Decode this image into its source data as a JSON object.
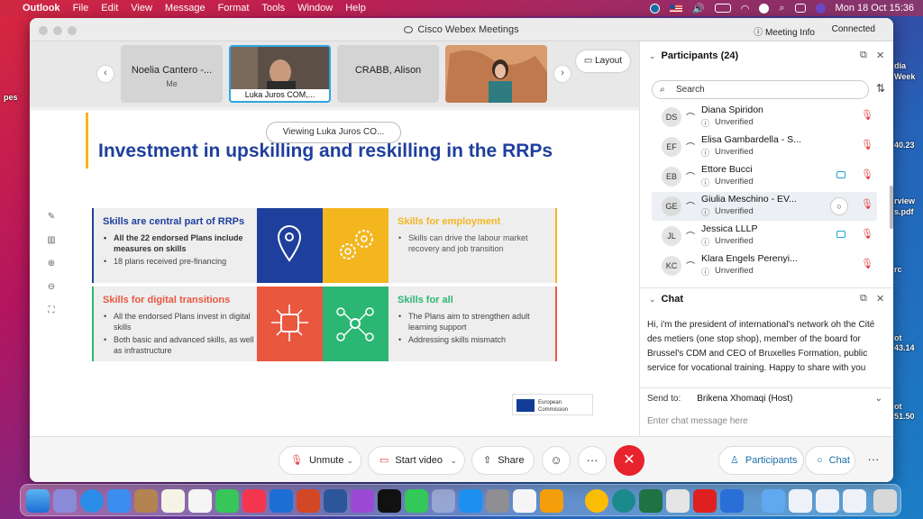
{
  "menubar": {
    "app": "Outlook",
    "items": [
      "File",
      "Edit",
      "View",
      "Message",
      "Format",
      "Tools",
      "Window",
      "Help"
    ],
    "datetime": "Mon 18 Oct  15:36"
  },
  "desktop": {
    "left_label": "pes",
    "right_labels": [
      "dia",
      "Week",
      "40.23",
      "rview",
      "s.pdf",
      "rc",
      "ot",
      "43.14",
      "ot",
      "51.50"
    ]
  },
  "window": {
    "title": "Cisco Webex Meetings",
    "meeting_info": "Meeting Info",
    "status": "Connected"
  },
  "thumbnails": [
    {
      "name": "Noelia Cantero -...",
      "sub": "Me"
    },
    {
      "name": "Luka Juros COM,...",
      "sub": ""
    },
    {
      "name": "CRABB, Alison",
      "sub": ""
    },
    {
      "name": "",
      "sub": ""
    }
  ],
  "layout_button": "Layout",
  "viewing_label": "Viewing Luka Juros CO...",
  "slide": {
    "title": "Investment in upskilling and reskilling in the RRPs",
    "cells": [
      {
        "heading": "Skills are central part of RRPs",
        "heading_color": "#1e3f9c",
        "bullets": [
          "All the 22 endorsed Plans include measures on skills",
          "18 plans received pre-financing"
        ]
      },
      {
        "heading": "Skills for employment",
        "heading_color": "#f3b61f",
        "bullets": [
          "Skills can drive the labour market recovery and job transition"
        ]
      },
      {
        "heading": "Skills for digital transitions",
        "heading_color": "#e9573f",
        "bullets": [
          "All the endorsed Plans invest in digital skills",
          "Both basic and advanced skills, as well as infrastructure"
        ]
      },
      {
        "heading": "Skills for all",
        "heading_color": "#2bb673",
        "bullets": [
          "The Plans aim to strengthen adult learning support",
          "Addressing skills mismatch"
        ]
      }
    ],
    "logo_text": [
      "European",
      "Commission"
    ]
  },
  "controls": {
    "unmute": "Unmute",
    "start_video": "Start video",
    "share": "Share",
    "participants": "Participants",
    "chat": "Chat"
  },
  "participants_panel": {
    "title": "Participants (24)",
    "search_placeholder": "Search",
    "people": [
      {
        "initials": "DS",
        "name": "Diana Spiridon",
        "status": "Unverified",
        "video": false,
        "chat": false,
        "highlight": false
      },
      {
        "initials": "EF",
        "name": "Elisa Gambardella - S...",
        "status": "Unverified",
        "video": false,
        "chat": false,
        "highlight": false
      },
      {
        "initials": "EB",
        "name": "Ettore Bucci",
        "status": "Unverified",
        "video": true,
        "chat": false,
        "highlight": false
      },
      {
        "initials": "GE",
        "name": "Giulia Meschino - EV...",
        "status": "Unverified",
        "video": false,
        "chat": true,
        "highlight": true
      },
      {
        "initials": "JL",
        "name": "Jessica LLLP",
        "status": "Unverified",
        "video": true,
        "chat": false,
        "highlight": false
      },
      {
        "initials": "KC",
        "name": "Klara Engels Perenyi...",
        "status": "Unverified",
        "video": false,
        "chat": false,
        "highlight": false
      }
    ]
  },
  "chat_panel": {
    "title": "Chat",
    "message": "Hi, i'm the president of international's network oh the Cité des metiers (one stop shop), member of the board for Brussel's CDM and CEO of Bruxelles Formation, public service for vocational training. Happy to share with you",
    "send_to_label": "Send to:",
    "send_to_value": "Brikena Xhomaqi (Host)",
    "input_placeholder": "Enter chat message here"
  }
}
